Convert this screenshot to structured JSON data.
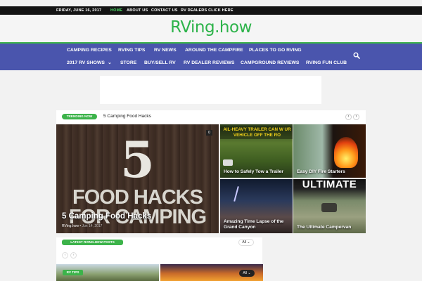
{
  "topbar": {
    "date": "FRIDAY, JUNE 16, 2017",
    "links": [
      "HOME",
      "ABOUT US",
      "CONTACT US",
      "RV DEALERS CLICK HERE"
    ]
  },
  "logo": "RVing.how",
  "nav": {
    "row1": [
      "CAMPING RECIPES",
      "RVING TIPS",
      "RV NEWS",
      "AROUND THE CAMPFIRE",
      "PLACES TO GO RVING"
    ],
    "row2": [
      "2017 RV SHOWS",
      "STORE",
      "BUY/SELL RV",
      "RV DEALER REVIEWS",
      "CAMPGROUND REVIEWS",
      "RVING FUN CLUB"
    ],
    "search_icon": "search-icon"
  },
  "trending": {
    "label": "TRENDING NOW",
    "title": "5 Camping Food Hacks",
    "prev": "‹",
    "next": "›"
  },
  "featured": {
    "image_number": "5",
    "image_text": "FOOD HACKS FOR CAMPING",
    "title": "5 Camping Food Hacks",
    "author": "RVing.how",
    "date": "Jun 14, 2017",
    "comments": "0"
  },
  "tiles": [
    {
      "title": "How to Safely Tow a Trailer",
      "image_text": "AIL-HEAVY TRAILER CAN W UR VEHICLE OFF THE RO"
    },
    {
      "title": "Easy DIY Fire Starters"
    },
    {
      "title": "Amazing Time Lapse of the Grand Canyon"
    },
    {
      "title": "The Ultimate Campervan",
      "image_text": "ULTIMATE"
    }
  ],
  "latest": {
    "label": "LATEST RVING.HOW POSTS",
    "filter": "All",
    "prev": "‹",
    "next": "›",
    "post_badge": "RV TIPS",
    "post2_filter": "All"
  },
  "colors": {
    "nav_bg": "#4a55ad",
    "accent_green": "#3cb34a",
    "topbar_bg": "#141414"
  }
}
